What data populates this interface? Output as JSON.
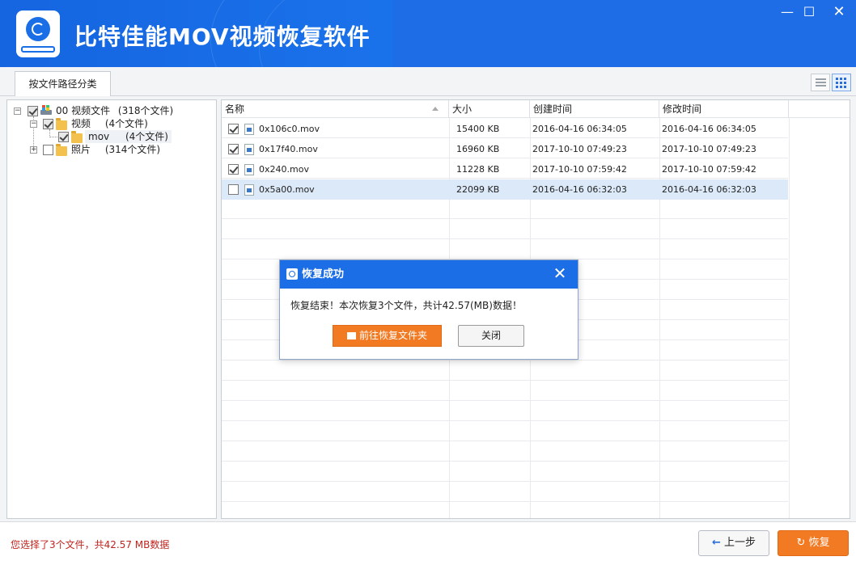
{
  "app": {
    "title": "比特佳能MOV视频恢复软件",
    "window_controls": {
      "minimize": "—",
      "maximize": "☐",
      "close": "✕"
    }
  },
  "tabs": [
    {
      "label": "按文件路径分类",
      "active": true
    }
  ],
  "view_toggle": {
    "options": [
      "list-view-icon",
      "grid-view-icon"
    ],
    "selected": "grid-view-icon"
  },
  "tree": {
    "items": [
      {
        "label": "00 视频文件",
        "count": "(318个文件)",
        "checked": "partial",
        "expanded": true,
        "icon": "drive-icon"
      },
      {
        "label": "视频",
        "count": "(4个文件)",
        "checked": "partial",
        "expanded": true,
        "icon": "folder-icon"
      },
      {
        "label": "mov",
        "count": "(4个文件)",
        "checked": "partial",
        "expanded": false,
        "icon": "folder-icon"
      },
      {
        "label": "照片",
        "count": "(314个文件)",
        "checked": "unchecked",
        "expanded": false,
        "icon": "folder-icon"
      }
    ]
  },
  "file_table": {
    "columns": [
      "名称",
      "大小",
      "创建时间",
      "修改时间"
    ],
    "rows": [
      {
        "name": "0x106c0.mov",
        "size": "15400 KB",
        "created": "2016-04-16  06:34:05",
        "modified": "2016-04-16  06:34:05",
        "checked": true,
        "selected": false
      },
      {
        "name": "0x17f40.mov",
        "size": "16960 KB",
        "created": "2017-10-10  07:49:23",
        "modified": "2017-10-10  07:49:23",
        "checked": true,
        "selected": false
      },
      {
        "name": "0x240.mov",
        "size": "11228 KB",
        "created": "2017-10-10  07:59:42",
        "modified": "2017-10-10  07:59:42",
        "checked": true,
        "selected": false
      },
      {
        "name": "0x5a00.mov",
        "size": "22099 KB",
        "created": "2016-04-16  06:32:03",
        "modified": "2016-04-16  06:32:03",
        "checked": false,
        "selected": true
      }
    ]
  },
  "dialog": {
    "title": "恢复成功",
    "message": "恢复结束！本次恢复3个文件，共计42.57(MB)数据！",
    "open_folder_label": "前往恢复文件夹",
    "close_label": "关闭",
    "close_glyph": "✕"
  },
  "status": {
    "selection_text": "您选择了3个文件，共42.57 MB数据"
  },
  "footer": {
    "prev_label": "上一步",
    "recover_label": "恢复",
    "prev_glyph": "←",
    "recover_glyph": "↻"
  },
  "colors": {
    "titlebar_blue": "#1a6fe6",
    "accent_orange": "#f27a22",
    "status_red": "#c0241e",
    "row_selected": "#dce9f8"
  }
}
